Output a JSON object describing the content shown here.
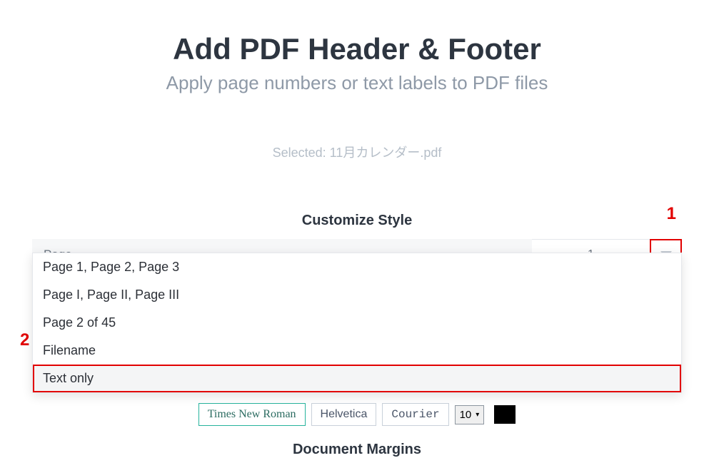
{
  "header": {
    "title": "Add PDF Header & Footer",
    "subtitle": "Apply page numbers or text labels to PDF files"
  },
  "selected": {
    "prefix": "Selected: ",
    "filename": "11月カレンダー.pdf"
  },
  "customize": {
    "heading": "Customize Style",
    "selected_label": "Page",
    "page_number_start": "1",
    "options": [
      "Page 1, Page 2, Page 3",
      "Page I, Page II, Page III",
      "Page 2 of 45",
      "Filename",
      "Text only"
    ]
  },
  "fonts": {
    "times": "Times New Roman",
    "helvetica": "Helvetica",
    "courier": "Courier",
    "size": "10"
  },
  "margins": {
    "heading": "Document Margins"
  },
  "annotations": {
    "one": "1",
    "two": "2"
  }
}
